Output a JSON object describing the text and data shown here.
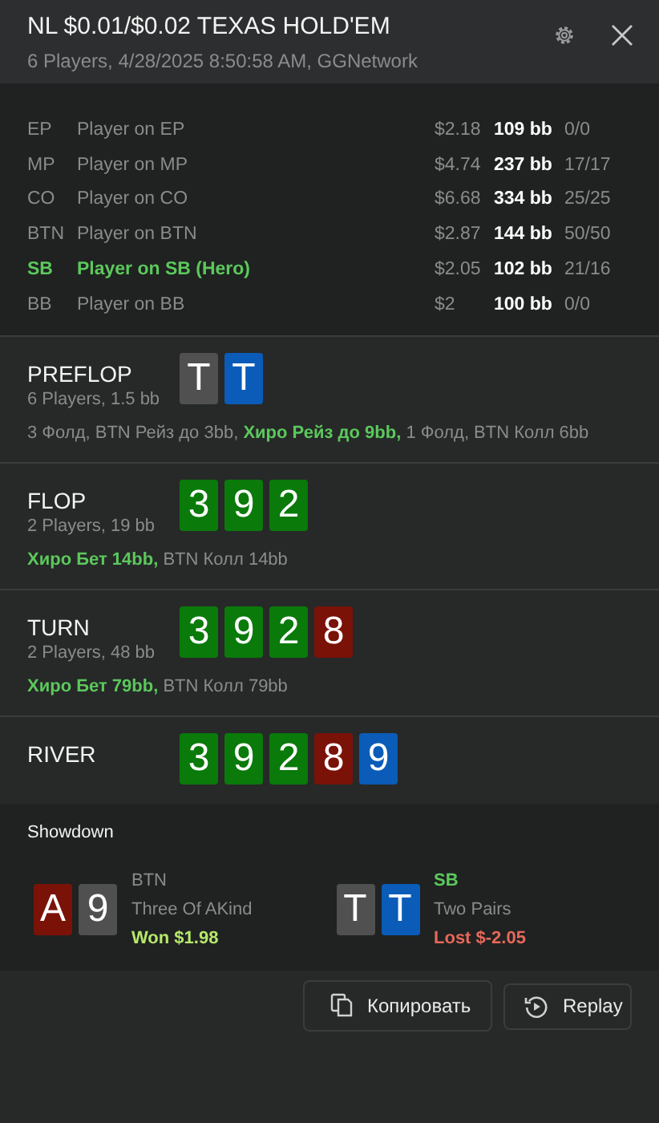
{
  "header": {
    "title": "NL $0.01/$0.02 TEXAS HOLD'EM",
    "subtitle": "6 Players, 4/28/2025 8:50:58 AM, GGNetwork"
  },
  "players": [
    {
      "position": "EP",
      "name": "Player on EP",
      "stack": "$2.18",
      "bb": "109 bb",
      "stats": "0/0",
      "hero": false
    },
    {
      "position": "MP",
      "name": "Player on MP",
      "stack": "$4.74",
      "bb": "237 bb",
      "stats": "17/17",
      "hero": false
    },
    {
      "position": "CO",
      "name": "Player on CO",
      "stack": "$6.68",
      "bb": "334 bb",
      "stats": "25/25",
      "hero": false
    },
    {
      "position": "BTN",
      "name": "Player on BTN",
      "stack": "$2.87",
      "bb": "144 bb",
      "stats": "50/50",
      "hero": false
    },
    {
      "position": "SB",
      "name": "Player on SB (Hero)",
      "stack": "$2.05",
      "bb": "102 bb",
      "stats": "21/16",
      "hero": true
    },
    {
      "position": "BB",
      "name": "Player on BB",
      "stack": "$2",
      "bb": "100 bb",
      "stats": "0/0",
      "hero": false
    }
  ],
  "streets": [
    {
      "name": "PREFLOP",
      "info": "6 Players, 1.5 bb",
      "cards": [
        {
          "rank": "T",
          "color": "#505050"
        },
        {
          "rank": "T",
          "color": "#0a5cb8"
        }
      ],
      "actions": "3 Фолд, BTN Рейз до 3bb, **Хиро Рейз до 9bb,** 1 Фолд, BTN Колл 6bb"
    },
    {
      "name": "FLOP",
      "info": "2 Players, 19 bb",
      "cards": [
        {
          "rank": "3",
          "color": "#0a7a0a"
        },
        {
          "rank": "9",
          "color": "#0a7a0a"
        },
        {
          "rank": "2",
          "color": "#0a7a0a"
        }
      ],
      "actions": "**Хиро Бет 14bb,** BTN Колл 14bb"
    },
    {
      "name": "TURN",
      "info": "2 Players, 48 bb",
      "cards": [
        {
          "rank": "3",
          "color": "#0a7a0a"
        },
        {
          "rank": "9",
          "color": "#0a7a0a"
        },
        {
          "rank": "2",
          "color": "#0a7a0a"
        },
        {
          "rank": "8",
          "color": "#7a1208"
        }
      ],
      "actions": "**Хиро Бет 79bb,** BTN Колл 79bb"
    },
    {
      "name": "RIVER",
      "cards": [
        {
          "rank": "3",
          "color": "#0a7a0a"
        },
        {
          "rank": "9",
          "color": "#0a7a0a"
        },
        {
          "rank": "2",
          "color": "#0a7a0a"
        },
        {
          "rank": "8",
          "color": "#7a1208"
        },
        {
          "rank": "9",
          "color": "#0a5cb8"
        }
      ]
    }
  ],
  "showdown": {
    "title": "Showdown",
    "hands": [
      {
        "position": "BTN",
        "hero": false,
        "cards": [
          {
            "rank": "A",
            "color": "#7a1208"
          },
          {
            "rank": "9",
            "color": "#505050"
          }
        ],
        "combination": "Three Of AKind",
        "result": "Won $1.98",
        "kind": "won"
      },
      {
        "position": "SB",
        "hero": true,
        "cards": [
          {
            "rank": "T",
            "color": "#505050"
          },
          {
            "rank": "T",
            "color": "#0a5cb8"
          }
        ],
        "combination": "Two Pairs",
        "result": "Lost $-2.05",
        "kind": "lost"
      }
    ]
  },
  "buttons": [
    {
      "label": "Копировать",
      "kind": "copy"
    },
    {
      "label": "Replay",
      "kind": "replay"
    }
  ]
}
